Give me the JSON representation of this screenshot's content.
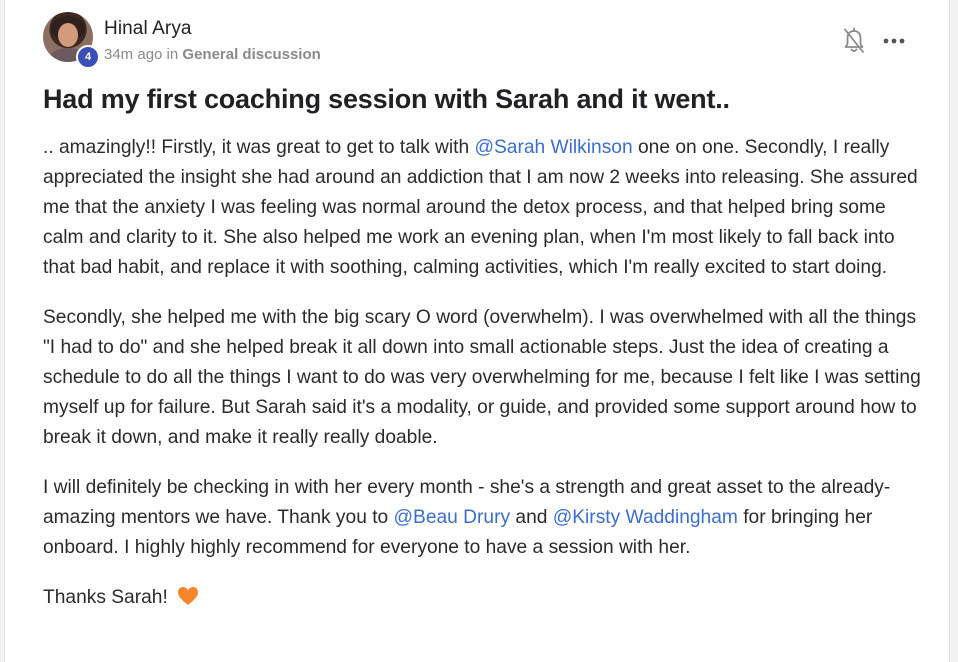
{
  "post": {
    "author": {
      "name": "Hinal Arya",
      "level": "4"
    },
    "time": "34m ago",
    "in_word": "in",
    "category": "General discussion",
    "title": "Had my first coaching session with Sarah and it went..",
    "paragraphs": [
      {
        "t1": ".. amazingly!! Firstly, it was great to get to talk with ",
        "m1": "@Sarah Wilkinson",
        "t2": " one on one. Secondly, I really appreciated the insight she had around an addiction that I am now 2 weeks into releasing. She assured me that the anxiety I was feeling was normal around the detox process, and that helped bring some calm and clarity to it. She also helped me work an evening plan, when I'm most likely to fall back into that bad habit, and replace it with soothing, calming activities, which I'm really excited to start doing."
      },
      {
        "t1": "Secondly, she helped me with the big scary O word (overwhelm). I was overwhelmed with all the things \"I had to do\" and she helped break it all down into small actionable steps. Just the idea of creating a schedule to do all the things I want to do was very overwhelming for me, because I felt like I was setting myself up for failure. But Sarah said it's a modality, or guide, and provided some support around how to break it down, and make it really really doable."
      },
      {
        "t1": "I will definitely be checking in with her every month - she's a strength and great asset to the already-amazing mentors we have. Thank you to ",
        "m1": "@Beau Drury",
        "t2": " and ",
        "m2": "@Kirsty Waddingham",
        "t3": " for bringing her onboard. I highly highly recommend for everyone to have a session with her."
      },
      {
        "t1": "Thanks Sarah! ",
        "emoji": "orange-heart"
      }
    ]
  },
  "icons": {
    "bell": "bell-off-icon",
    "more": "more-horizontal-icon"
  },
  "colors": {
    "mention": "#3a6fd0",
    "badge": "#3b4fb8",
    "heart": "#f5862b"
  }
}
